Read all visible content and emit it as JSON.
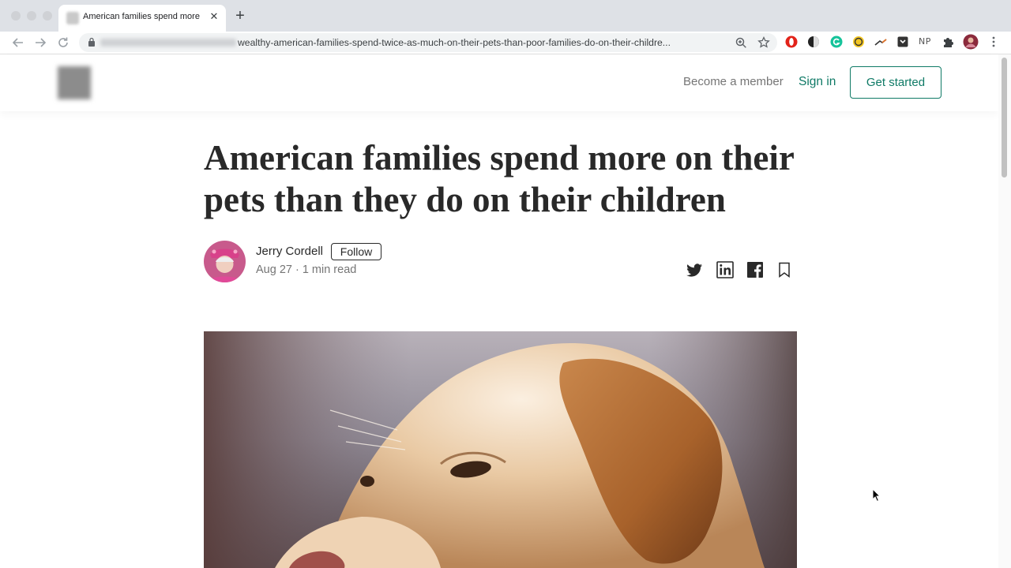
{
  "browser": {
    "tab": {
      "title": "American families spend more",
      "close_glyph": "✕"
    },
    "newtab_glyph": "+",
    "address": {
      "url_visible": "wealthy-american-families-spend-twice-as-much-on-their-pets-than-poor-families-do-on-their-childre..."
    },
    "icons": {
      "back": "back-arrow-icon",
      "forward": "forward-arrow-icon",
      "reload": "reload-icon",
      "lock": "lock-icon",
      "zoom": "zoom-icon",
      "bookmark_star": "star-icon",
      "extensions": [
        "opera-extension-icon",
        "dark-reader-icon",
        "grammarly-icon",
        "coin-extension-icon",
        "eyedropper-icon",
        "pocket-icon",
        "np-extension-icon",
        "puzzle-extensions-icon",
        "profile-avatar-icon",
        "kebab-menu-icon"
      ],
      "np_text": "NP"
    }
  },
  "header": {
    "become_member": "Become a member",
    "sign_in": "Sign in",
    "get_started": "Get started"
  },
  "article": {
    "title": "American families spend more on their pets than they do on their children",
    "author": "Jerry Cordell",
    "follow": "Follow",
    "date": "Aug 27",
    "separator": "·",
    "read_time": "1 min read",
    "share_icons": [
      "twitter-icon",
      "linkedin-icon",
      "facebook-icon",
      "bookmark-icon"
    ],
    "hero_image": "golden-labrador-closeup"
  },
  "colors": {
    "accent_green": "#0f7a66",
    "text_dark": "#292929",
    "text_muted": "#757575",
    "chrome_bg": "#dee1e6"
  }
}
